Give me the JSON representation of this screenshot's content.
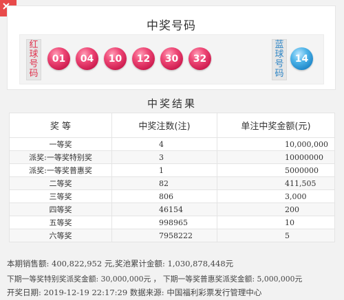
{
  "draw": {
    "title": "中奖号码",
    "red_label": [
      "红",
      "球",
      "号",
      "码"
    ],
    "blue_label": [
      "蓝",
      "球",
      "号",
      "码"
    ],
    "red_balls": [
      "01",
      "04",
      "10",
      "12",
      "30",
      "32"
    ],
    "blue_ball": "14"
  },
  "result": {
    "title": "中奖结果",
    "headers": [
      "奖  等",
      "中奖注数(注)",
      "单注中奖金额(元)"
    ],
    "rows": [
      [
        "一等奖",
        "4",
        "10,000,000"
      ],
      [
        "派奖:一等奖特别奖",
        "3",
        "10000000"
      ],
      [
        "派奖:一等奖普惠奖",
        "1",
        "5000000"
      ],
      [
        "二等奖",
        "82",
        "411,505"
      ],
      [
        "三等奖",
        "806",
        "3,000"
      ],
      [
        "四等奖",
        "46154",
        "200"
      ],
      [
        "五等奖",
        "998965",
        "10"
      ],
      [
        "六等奖",
        "7958222",
        "5"
      ]
    ]
  },
  "footer": {
    "line1": "本期销售额: 400,822,952 元,奖池累计金额: 1,030,878,448元",
    "line2": "下期一等奖特别奖派奖金额: 30,000,000元 ， 下期一等奖普惠奖派奖金额: 5,000,000元",
    "line3": "开奖日期: 2019-12-19 22:17:29  数据来源: 中国福利彩票发行管理中心"
  },
  "colors": {
    "red_ball": "#e23a6a",
    "blue_ball": "#2a95d6",
    "corner": "#e84a4a"
  },
  "icons": {
    "corner": "close-x-icon"
  }
}
